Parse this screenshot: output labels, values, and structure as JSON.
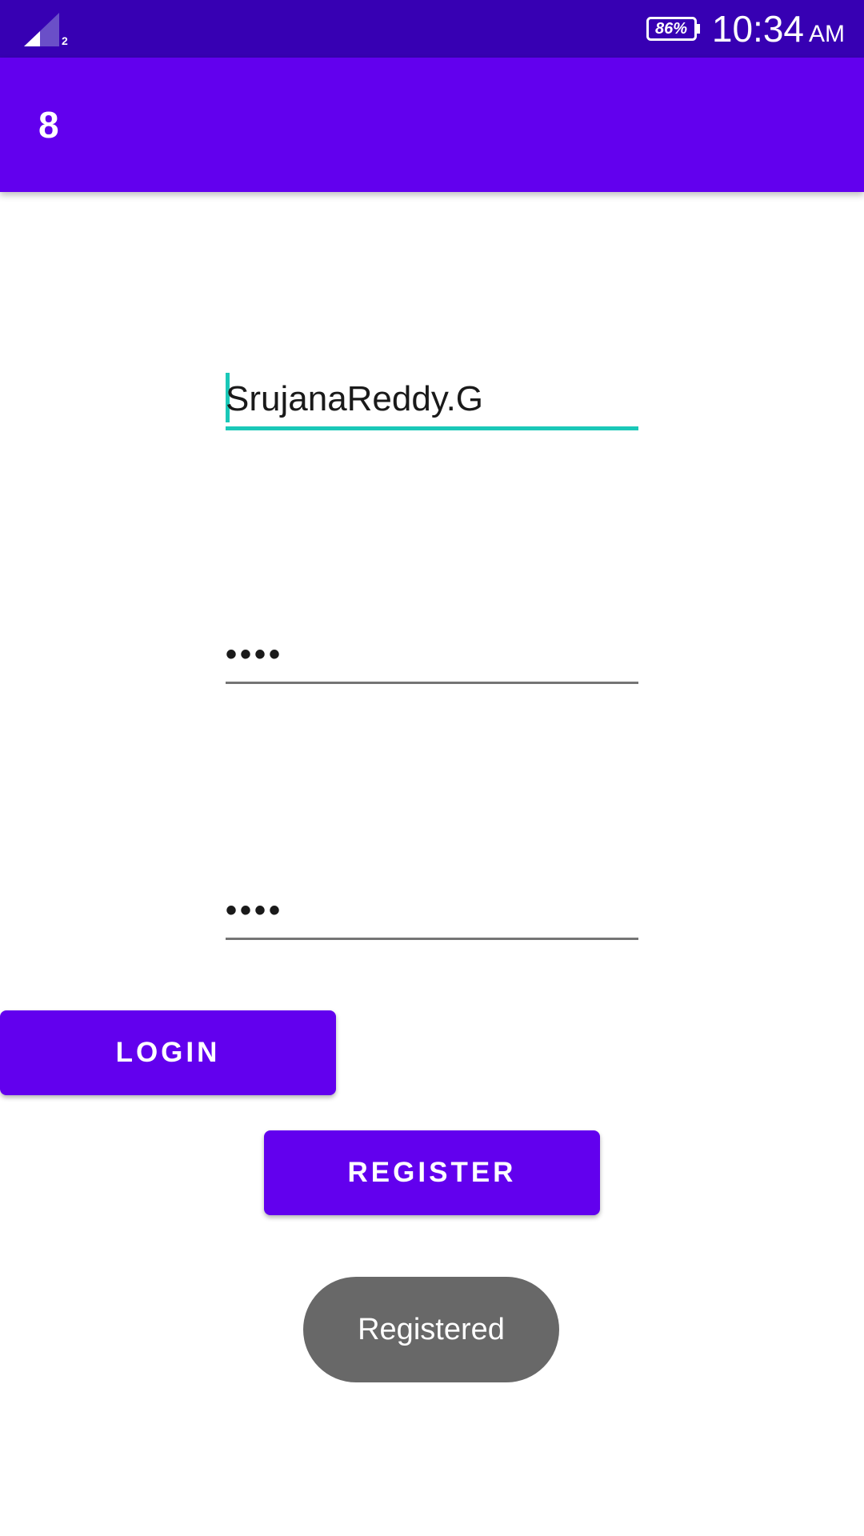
{
  "status_bar": {
    "sim_number": "2",
    "battery": "86%",
    "time": "10:34",
    "ampm": "AM"
  },
  "app_bar": {
    "title": "8"
  },
  "form": {
    "username_value": "SrujanaReddy.G",
    "password_value": "••••",
    "confirm_value": "••••"
  },
  "buttons": {
    "login_label": "LOGIN",
    "register_label": "REGISTER"
  },
  "toast": {
    "message": "Registered"
  },
  "colors": {
    "status_bar": "#3700b3",
    "primary": "#6200ee",
    "accent": "#1ac8b8",
    "toast_bg": "#686868"
  },
  "icons": {
    "signal": "cellular-signal-icon",
    "battery": "battery-icon"
  }
}
